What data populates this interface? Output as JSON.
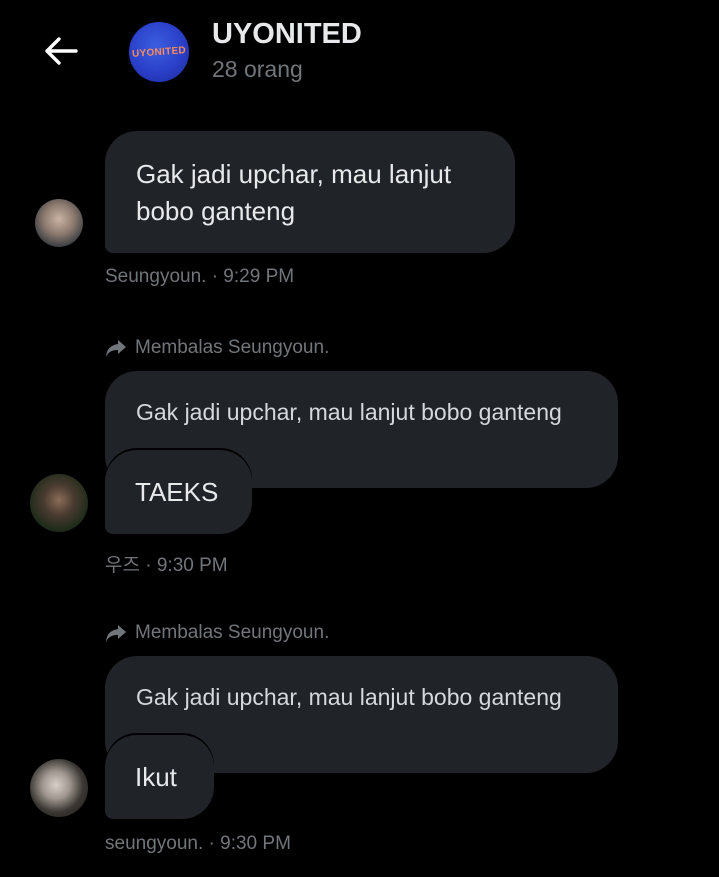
{
  "header": {
    "group_name": "UYONITED",
    "member_count": "28 orang",
    "avatar_logo_text": "UYONITED"
  },
  "messages": [
    {
      "text": "Gak jadi upchar, mau lanjut bobo ganteng",
      "meta": "Seungyoun. · 9:29 PM"
    },
    {
      "reply_label": "Membalas Seungyoun.",
      "quoted": "Gak jadi upchar, mau lanjut bobo ganteng",
      "text": "TAEKS",
      "meta": "우즈 · 9:30 PM"
    },
    {
      "reply_label": "Membalas Seungyoun.",
      "quoted": "Gak jadi upchar, mau lanjut bobo ganteng",
      "text": "Ikut",
      "meta": "seungyoun. · 9:30 PM"
    }
  ],
  "colors": {
    "background": "#000000",
    "bubble": "#202327",
    "text": "#e7e9ea",
    "muted": "#71767b"
  }
}
